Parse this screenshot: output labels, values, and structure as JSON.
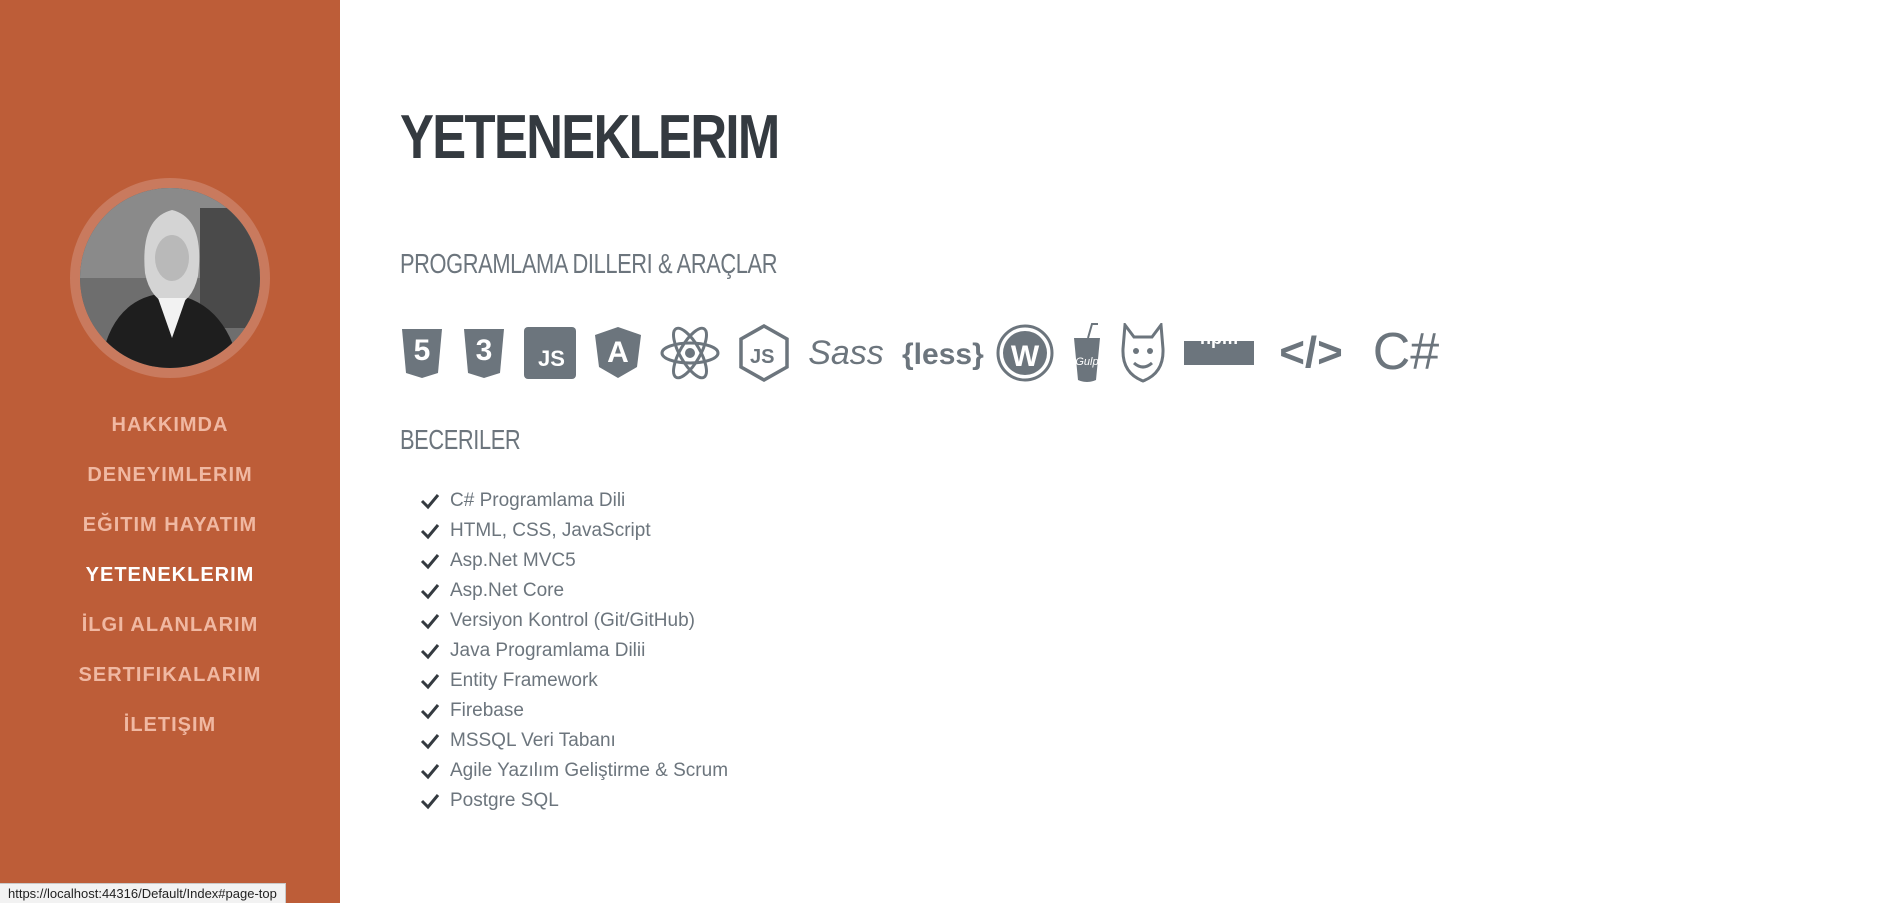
{
  "nav": [
    {
      "label": "HAKKIMDA",
      "active": false
    },
    {
      "label": "DENEYIMLERIM",
      "active": false
    },
    {
      "label": "EĞITIM HAYATIM",
      "active": false
    },
    {
      "label": "YETENEKLERIM",
      "active": true
    },
    {
      "label": "İLGI ALANLARIM",
      "active": false
    },
    {
      "label": "SERTIFIKALARIM",
      "active": false
    },
    {
      "label": "İLETIŞIM",
      "active": false
    }
  ],
  "status_bar": {
    "url": "https://localhost:44316/Default/Index#page-top"
  },
  "main": {
    "title": "YETENEKLERIM",
    "tools_heading": "PROGRAMLAMA DILLERI & ARAÇLAR",
    "skills_heading": "BECERILER",
    "tool_icons": [
      {
        "name": "html5-icon",
        "text": "5"
      },
      {
        "name": "css3-icon",
        "text": "3"
      },
      {
        "name": "js-square-icon",
        "text": "JS"
      },
      {
        "name": "angular-icon",
        "text": "A"
      },
      {
        "name": "react-icon",
        "text": ""
      },
      {
        "name": "nodejs-icon",
        "text": "JS"
      },
      {
        "name": "sass-icon",
        "text": "Sass"
      },
      {
        "name": "less-icon",
        "text": "{less}"
      },
      {
        "name": "wordpress-icon",
        "text": "W"
      },
      {
        "name": "gulp-icon",
        "text": "Gulp"
      },
      {
        "name": "grunt-icon",
        "text": ""
      },
      {
        "name": "npm-icon",
        "text": "npm"
      },
      {
        "name": "code-icon",
        "text": "</>"
      },
      {
        "name": "csharp-icon",
        "text": "C#"
      }
    ],
    "skills": [
      "C# Programlama Dili",
      "HTML, CSS, JavaScript",
      "Asp.Net MVC5",
      "Asp.Net Core",
      "Versiyon Kontrol (Git/GitHub)",
      "Java Programlama Dilii",
      "Entity Framework",
      "Firebase",
      "MSSQL Veri Tabanı",
      "Agile Yazılım Geliştirme & Scrum",
      "Postgre SQL"
    ]
  },
  "colors": {
    "sidebar": "#bd5d38",
    "heading": "#343a40",
    "muted": "#6c757d",
    "nav_link": "#f0b8a2"
  }
}
